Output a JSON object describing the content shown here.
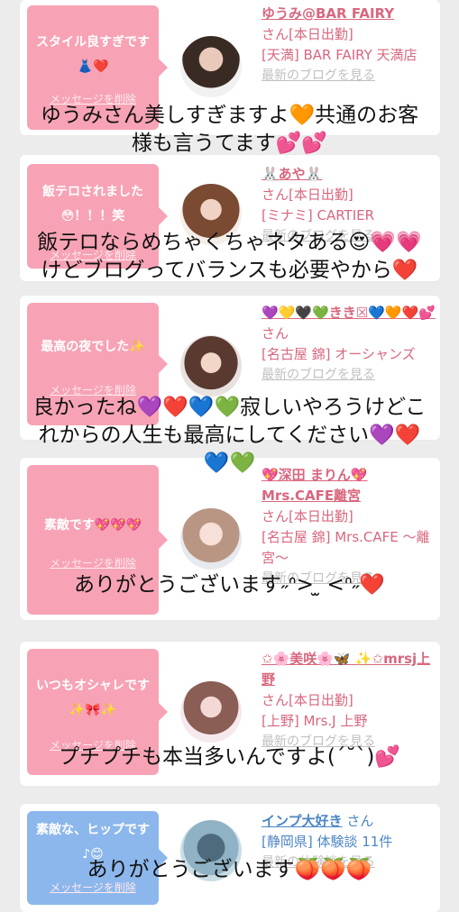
{
  "cards": [
    {
      "bubble": "スタイル良すぎです👗❤️",
      "delete": "メッセージを削除",
      "name": "ゆうみ@BAR FAIRY",
      "suffix": "さん[本日出勤]",
      "shop": "[天満] BAR FAIRY 天満店",
      "blog": "最新のブログを見る"
    },
    {
      "bubble": "飯テロされました😳！！！笑",
      "delete": "メッセージを削除",
      "name": "🐰あや🐰",
      "suffix": "さん[本日出勤]",
      "shop": "[ミナミ] CARTIER",
      "blog": "最新のブログを見る"
    },
    {
      "bubble": "最高の夜でした✨",
      "delete": "メッセージを削除",
      "name": "💜💛🖤💚きき☒💙🧡❤️💕",
      "suffix": "さん",
      "shop": "[名古屋 錦] オーシャンズ",
      "blog": "最新のブログを見る"
    },
    {
      "bubble": "素敵です💖💖💖",
      "delete": "メッセージを削除",
      "name": "💖深田 まりん💖 Mrs.CAFE離宮",
      "suffix": "さん[本日出勤]",
      "shop": "[名古屋 錦] Mrs.CAFE 〜離宮〜",
      "blog": "最新のブログを見る"
    },
    {
      "bubble": "いつもオシャレです✨🎀✨",
      "delete": "メッセージを削除",
      "name": "✩🌸美咲🌸🦋 ✨✩mrsj上野",
      "suffix": "さん[本日出勤]",
      "shop": "[上野] Mrs.J 上野",
      "blog": "最新のブログを見る"
    },
    {
      "bubble": "素敵な、ヒップです♪😊",
      "delete": "メッセージを削除",
      "name": "インプ大好き",
      "suffix": "さん",
      "shop": "[静岡県] 体験談 11件",
      "blog": "最新の体験談を見る"
    }
  ],
  "overlays": [
    "ゆうみさん美しすぎますよ🧡共通のお客",
    "様も言うてます💕💕",
    "飯テロならめちゃくちゃネタある😍💗💗",
    "けどブログってバランスも必要やから❤️",
    "良かったね💜❤️💙💚寂しいやろうけどこ",
    "れからの人生も最高にしてください💜❤️",
    "💙💚",
    "ありがとうございます˶ᐢ> ̫ <ᐢ˶❤️",
    "プチプチも本当多いんですよ(ˊ˘ˋ)💕",
    "ありがとうございます🍑🍑🍑"
  ],
  "colors": {
    "pink_bubble": "#f7a3b5",
    "blue_bubble": "#8cb7ec",
    "pink_text": "#d8677e",
    "blue_text": "#4d86c5"
  }
}
